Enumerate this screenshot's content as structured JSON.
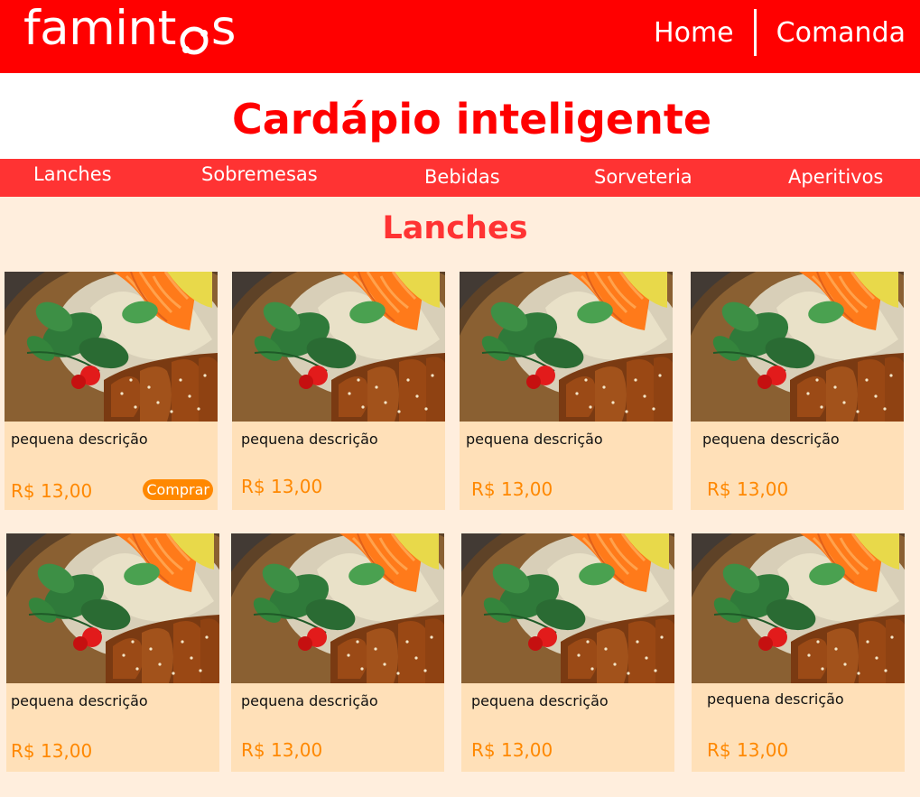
{
  "brand": {
    "logo_prefix": "famint",
    "logo_suffix": "s",
    "logo_o_icon": "ring-with-two-dots-icon",
    "color": "#ff0000"
  },
  "nav": {
    "home": "Home",
    "comanda": "Comanda"
  },
  "page": {
    "title": "Cardápio inteligente"
  },
  "categories": [
    "Lanches",
    "Sobremesas",
    "Bebidas",
    "Sorveteria",
    "Aperitivos"
  ],
  "section": {
    "title": "Lanches"
  },
  "products": [
    {
      "description": "pequena descrição",
      "price": "R$ 13,00",
      "image": "food-bowl-photo",
      "buy_label": "Comprar"
    },
    {
      "description": "pequena descrição",
      "price": "R$ 13,00",
      "image": "food-bowl-photo"
    },
    {
      "description": "pequena descrição",
      "price": "R$ 13,00",
      "image": "food-bowl-photo"
    },
    {
      "description": "pequena descrição",
      "price": "R$ 13,00",
      "image": "food-bowl-photo"
    },
    {
      "description": "pequena descrição",
      "price": "R$ 13,00",
      "image": "food-bowl-photo"
    },
    {
      "description": "pequena descrição",
      "price": "R$ 13,00",
      "image": "food-bowl-photo"
    },
    {
      "description": "pequena descrição",
      "price": "R$ 13,00",
      "image": "food-bowl-photo"
    },
    {
      "description": "pequena descrição",
      "price": "R$ 13,00",
      "image": "food-bowl-photo"
    }
  ],
  "colors": {
    "header": "#ff0000",
    "category_bar": "#ff3333",
    "background": "#ffeedd",
    "card": "#ffe0b8",
    "price": "#ff8800",
    "button": "#ff8800"
  }
}
